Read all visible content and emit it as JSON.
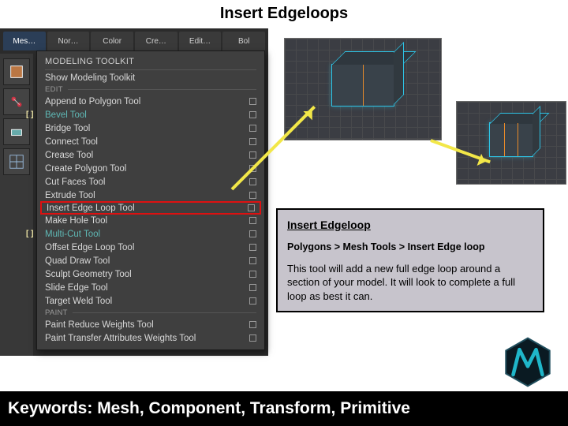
{
  "title": "Insert Edgeloops",
  "shelf_tabs": [
    "Mes…",
    "Nor…",
    "Color",
    "Cre…",
    "Edit…",
    "Bol"
  ],
  "shelf_active_index": 0,
  "menu": {
    "header": "MODELING TOOLKIT",
    "show_line": "Show Modeling Toolkit",
    "edit_section_label": "EDIT",
    "edit_items": [
      {
        "label": "Append to Polygon Tool",
        "poly_mark": false
      },
      {
        "label": "Bevel Tool",
        "accent": true,
        "poly_mark": true
      },
      {
        "label": "Bridge Tool"
      },
      {
        "label": "Connect Tool"
      },
      {
        "label": "Crease Tool"
      },
      {
        "label": "Create Polygon Tool"
      },
      {
        "label": "Cut Faces Tool"
      },
      {
        "label": "Extrude Tool"
      },
      {
        "label": "Insert Edge Loop Tool",
        "highlight_red": true
      },
      {
        "label": "Make Hole Tool"
      },
      {
        "label": "Multi-Cut Tool",
        "accent": true,
        "poly_mark": true
      },
      {
        "label": "Offset Edge Loop Tool"
      },
      {
        "label": "Quad Draw Tool"
      },
      {
        "label": "Sculpt Geometry Tool"
      },
      {
        "label": "Slide Edge Tool"
      },
      {
        "label": "Target Weld Tool"
      }
    ],
    "paint_section_label": "PAINT",
    "paint_items": [
      {
        "label": "Paint Reduce Weights Tool"
      },
      {
        "label": "Paint Transfer Attributes Weights Tool"
      }
    ]
  },
  "explanation": {
    "heading": "Insert Edgeloop",
    "path": "Polygons > Mesh Tools > Insert Edge loop",
    "body": "This tool will add a new full edge loop around a section of your model. It will look to complete a full loop as best it can."
  },
  "keywords": "Keywords: Mesh, Component, Transform, Primitive"
}
